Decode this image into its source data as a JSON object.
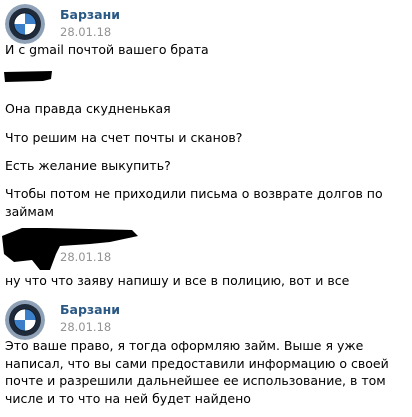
{
  "messages": [
    {
      "sender": "Барзани",
      "date": "28.01.18",
      "lines": [
        "И с gmail почтой вашего брата",
        "Она правда скудненькая",
        "Что решим на счет почты и сканов?",
        "Есть желание выкупить?",
        "Чтобы потом не приходили письма о возврате долгов по займам"
      ]
    },
    {
      "sender": "",
      "date": "28.01.18",
      "lines": [
        "ну что что заяву напишу и все в полицию, вот и все"
      ]
    },
    {
      "sender": "Барзани",
      "date": "28.01.18",
      "lines": [
        "Это ваше право, я тогда оформляю займ. Выше я уже написал, что вы сами предоставили информацию о своей почте и разрешили дальнейшее ее использование, в том числе и то что на ней будет найдено"
      ]
    }
  ],
  "colors": {
    "sender_name": "#2a5885",
    "date": "#939393",
    "redaction": "#000000"
  },
  "icons": {
    "avatar": "bmw-logo-avatar"
  }
}
